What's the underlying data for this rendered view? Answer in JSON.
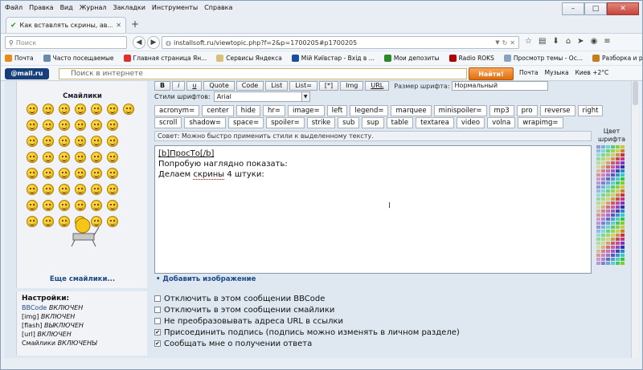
{
  "window": {
    "menu": [
      "Файл",
      "Правка",
      "Вид",
      "Журнал",
      "Закладки",
      "Инструменты",
      "Справка"
    ]
  },
  "tab": {
    "title": "Как вставлять скрины, ав..."
  },
  "nav": {
    "search_placeholder": "Поиск",
    "url": "installsoft.ru/viewtopic.php?f=2&p=1700205#p1700205"
  },
  "bookmarks": [
    {
      "label": "Почта",
      "color": "#e88b1a"
    },
    {
      "label": "Часто посещаемые",
      "color": "#6b8ab0"
    },
    {
      "label": "Главная страница Ян...",
      "color": "#e02f2f"
    },
    {
      "label": "Сервисы Яндекса",
      "color": "#d9c078"
    },
    {
      "label": "Мій Київстар - Вхід в ...",
      "color": "#1a4fa0"
    },
    {
      "label": "Мои депозиты",
      "color": "#2a8a2a"
    },
    {
      "label": "Radio ROKS",
      "color": "#b00000"
    },
    {
      "label": "Просмотр темы - Ос...",
      "color": "#8aa2bf"
    },
    {
      "label": "Разборка и ремонт р...",
      "color": "#c87d1a"
    }
  ],
  "mailbar": {
    "logo": "@mail.ru",
    "search_placeholder": "Поиск в интернете",
    "find_button": "Найти!",
    "mail": "Почта",
    "music": "Музыка",
    "weather": "Киев +2°C"
  },
  "smilies": {
    "title": "Смайлики",
    "more": "Еще смайлики..."
  },
  "editor": {
    "buttons_row1": [
      "B",
      "i",
      "u",
      "Quote",
      "Code",
      "List",
      "List=",
      "[*]",
      "Img",
      "URL"
    ],
    "size_label": "Размер шрифта:",
    "size_value": "Нормальный",
    "font_label": "Стили шрифтов:",
    "font_value": "Arial",
    "buttons_row3": [
      "acronym=",
      "center",
      "hide",
      "hr=",
      "image=",
      "left",
      "legend=",
      "marquee",
      "minispoiler=",
      "mp3",
      "pro",
      "reverse",
      "right"
    ],
    "buttons_row4": [
      "scroll",
      "shadow=",
      "space=",
      "spoiler=",
      "strike",
      "sub",
      "sup",
      "table",
      "textarea",
      "video",
      "volna",
      "wrapimg="
    ],
    "tip": "Совет: Можно быстро применить стили к выделенному тексту.",
    "text_line1": "[b]ПросТо[/b]",
    "text_line2": "Попробую наглядно показать:",
    "text_line3a": "Делаем ",
    "text_line3b": "скрины",
    "text_line3c": " 4 штуки:",
    "add_image": "• Добавить изображение",
    "color_label": "Цвет шрифта"
  },
  "settings": {
    "title": "Настройки:",
    "items": [
      {
        "name": "BBCode",
        "state": "ВКЛЮЧЕН"
      },
      {
        "name": "[img]",
        "state": "ВКЛЮЧЕН"
      },
      {
        "name": "[flash]",
        "state": "ВЫКЛЮЧЕН"
      },
      {
        "name": "[url]",
        "state": "ВКЛЮЧЕН"
      },
      {
        "name": "Смайлики",
        "state": "ВКЛЮЧЕНЫ"
      }
    ]
  },
  "options": [
    {
      "label": "Отключить в этом сообщении BBCode",
      "checked": false
    },
    {
      "label": "Отключить в этом сообщении смайлики",
      "checked": false
    },
    {
      "label": "Не преобразовывать адреса URL в ссылки",
      "checked": false
    },
    {
      "label": "Присоединить подпись (подпись можно изменять в личном разделе)",
      "checked": true
    },
    {
      "label": "Сообщать мне о получении ответа",
      "checked": true
    }
  ]
}
